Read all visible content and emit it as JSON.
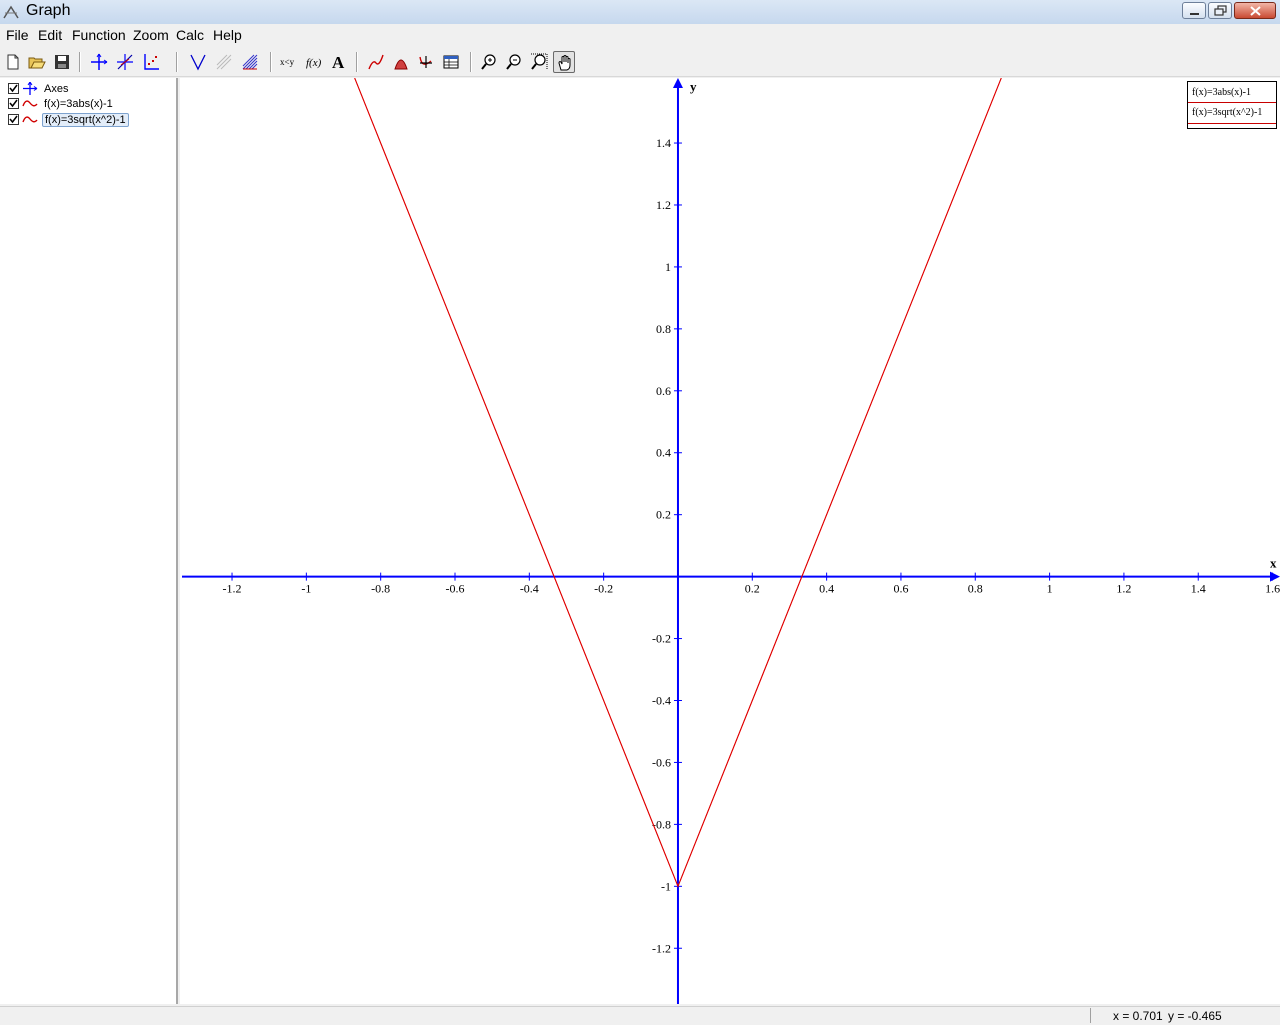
{
  "window": {
    "title": "Graph"
  },
  "menu": [
    "File",
    "Edit",
    "Function",
    "Zoom",
    "Calc",
    "Help"
  ],
  "toolbar": {
    "buttons": [
      "new-file",
      "open-file",
      "save-file",
      "axes",
      "insert-function",
      "insert-point-series",
      "tangent",
      "shading-disabled",
      "shading",
      "relation",
      "insert-f-of-x",
      "label-text",
      "trendline",
      "evaluate",
      "intersect",
      "table",
      "zoom-in",
      "zoom-out",
      "zoom-window",
      "pan-hand"
    ]
  },
  "tree": {
    "items": [
      {
        "label": "Axes",
        "checked": true,
        "icon": "axes-icon"
      },
      {
        "label": "f(x)=3abs(x)-1",
        "checked": true,
        "icon": "function-wave-icon"
      },
      {
        "label": "f(x)=3sqrt(x^2)-1",
        "checked": true,
        "icon": "function-wave-icon",
        "selected": true
      }
    ]
  },
  "legend": [
    "f(x)=3abs(x)-1",
    "f(x)=3sqrt(x^2)-1"
  ],
  "status": {
    "x": "x = 0.701",
    "y": "y = -0.465"
  },
  "colors": {
    "axes": "#0000ff",
    "curve": "#e00000"
  },
  "chart_data": {
    "type": "line",
    "title": "",
    "xlabel": "x",
    "ylabel": "y",
    "xlim": [
      -1.34,
      1.62
    ],
    "ylim": [
      -1.38,
      1.61
    ],
    "xticks": [
      -1.2,
      -1,
      -0.8,
      -0.6,
      -0.4,
      -0.2,
      0.2,
      0.4,
      0.6,
      0.8,
      1,
      1.2,
      1.4,
      1.6
    ],
    "yticks": [
      -1.2,
      -1,
      -0.8,
      -0.6,
      -0.4,
      -0.2,
      0.2,
      0.4,
      0.6,
      0.8,
      1,
      1.2,
      1.4
    ],
    "x_tick_labels": [
      "-1.2",
      "-1",
      "-0.8",
      "-0.6",
      "-0.4",
      "-0.2",
      "0.2",
      "0.4",
      "0.6",
      "0.8",
      "1",
      "1.2",
      "1.4",
      "1.6"
    ],
    "y_tick_labels": [
      "-1.2",
      "-1",
      "-0.8",
      "-0.6",
      "-0.4",
      "-0.2",
      "0.2",
      "0.4",
      "0.6",
      "0.8",
      "1",
      "1.2",
      "1.4"
    ],
    "grid": false,
    "series": [
      {
        "name": "f(x)=3abs(x)-1",
        "x": [
          -0.87,
          0,
          0.87
        ],
        "values": [
          1.61,
          -1,
          1.61
        ]
      },
      {
        "name": "f(x)=3sqrt(x^2)-1",
        "x": [
          -0.87,
          0,
          0.87
        ],
        "values": [
          1.61,
          -1,
          1.61
        ]
      }
    ]
  }
}
